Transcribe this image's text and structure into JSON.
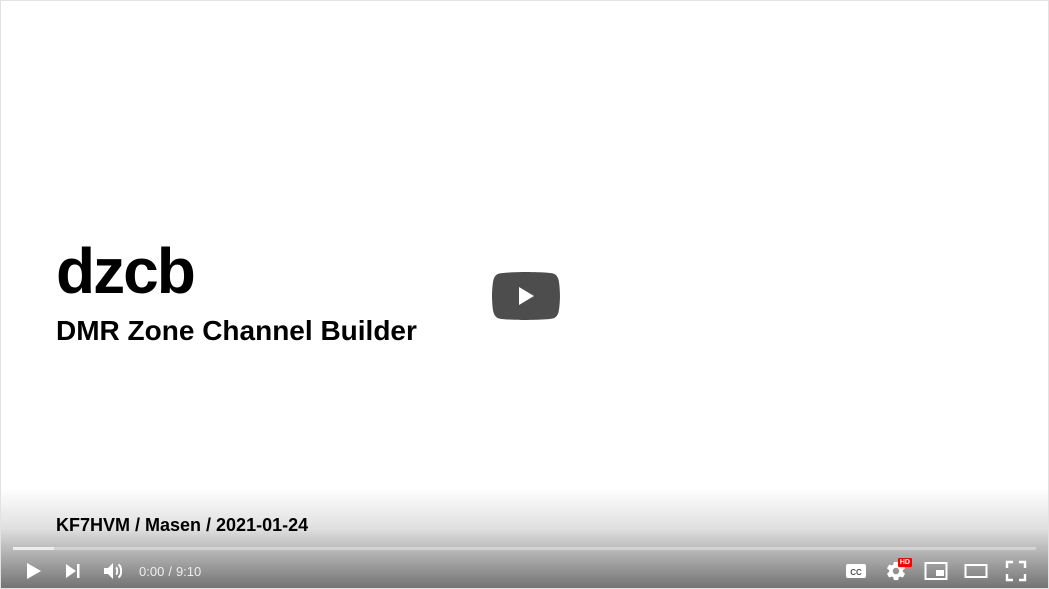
{
  "slide": {
    "title": "dzcb",
    "subtitle": "DMR Zone Channel Builder",
    "footer": "KF7HVM / Masen / 2021-01-24"
  },
  "player": {
    "current_time": "0:00",
    "separator": "/",
    "duration": "9:10",
    "progress_played": 0.0,
    "progress_loaded": 0.04,
    "hd_badge": "HD",
    "accent_color": "#ff0000"
  },
  "icons": {
    "big_play": "play-button-icon",
    "play": "play-icon",
    "next": "skip-next-icon",
    "volume": "volume-icon",
    "subtitles": "closed-captions-icon",
    "settings": "gear-icon",
    "miniplayer": "miniplayer-icon",
    "theater": "theater-mode-icon",
    "fullscreen": "fullscreen-icon"
  }
}
